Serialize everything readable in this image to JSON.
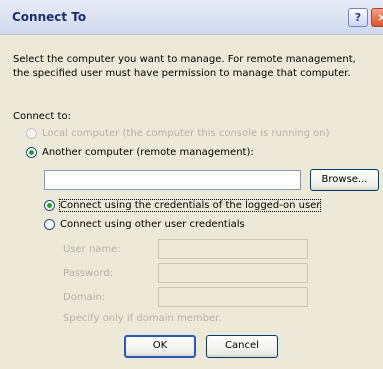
{
  "window": {
    "title": "Connect To",
    "help_label": "?",
    "close_label": "×"
  },
  "description": "Select the computer you want to manage. For remote management, the specified user must have permission to manage that computer.",
  "connect_to_label": "Connect to:",
  "options": {
    "local": {
      "label": "Local computer (the computer this console is running on)",
      "checked": false,
      "enabled": false
    },
    "another": {
      "label": "Another computer (remote management):",
      "checked": true,
      "enabled": true
    }
  },
  "computer_field": {
    "value": ""
  },
  "browse_label": "Browse...",
  "credentials": {
    "logged_on": {
      "label": "Connect using the credentials of the logged-on user",
      "checked": true
    },
    "other": {
      "label": "Connect using other user credentials",
      "checked": false
    }
  },
  "fields": {
    "user_name_label": "User name:",
    "password_label": "Password:",
    "domain_label": "Domain:",
    "user_name_value": "",
    "password_value": "",
    "domain_value": ""
  },
  "hint": "Specify only if domain member.",
  "buttons": {
    "ok": "OK",
    "cancel": "Cancel"
  }
}
